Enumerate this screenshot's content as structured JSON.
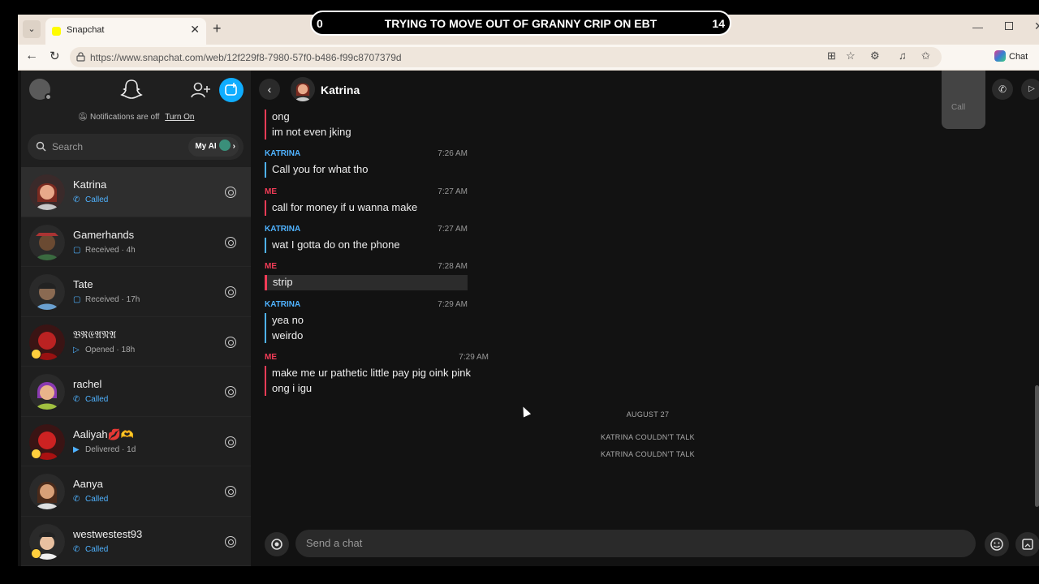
{
  "browser": {
    "tab_title": "Snapchat",
    "tab_close": "✕",
    "new_tab": "+",
    "url": "https://www.snapchat.com/web/12f229f8-7980-57f0-b486-f99c8707379d",
    "chat_badge": "Chat"
  },
  "overlay": {
    "left_number": "0",
    "text": "TRYING TO MOVE OUT OF GRANNY CRIP ON EBT",
    "right_number": "14"
  },
  "sidebar": {
    "notifications_text": "Notifications are off",
    "notifications_link": "Turn On",
    "search_placeholder": "Search",
    "my_ai_label": "My AI",
    "conversations": [
      {
        "name": "Katrina",
        "status": "Called",
        "status_type": "called",
        "icon": "phone-icon",
        "active": true
      },
      {
        "name": "Gamerhands",
        "status": "Received · 4h",
        "status_type": "received",
        "icon": "chat-bubble-icon"
      },
      {
        "name": "Tate",
        "status": "Received · 17h",
        "status_type": "received",
        "icon": "chat-bubble-icon"
      },
      {
        "name": "𝔅ℜ𝔈𝔄𝔑𝔄",
        "status": "Opened · 18h",
        "status_type": "opened",
        "icon": "arrow-outline-icon"
      },
      {
        "name": "rachel",
        "status": "Called",
        "status_type": "called",
        "icon": "phone-icon"
      },
      {
        "name": "Aaliyah💋🫶",
        "status": "Delivered · 1d",
        "status_type": "delivered",
        "icon": "arrow-filled-icon"
      },
      {
        "name": "Aanya",
        "status": "Called",
        "status_type": "called",
        "icon": "phone-icon"
      },
      {
        "name": "westwestest93",
        "status": "Called",
        "status_type": "called",
        "icon": "phone-icon"
      }
    ]
  },
  "chat": {
    "name": "Katrina",
    "call_label": "Call",
    "composer_placeholder": "Send a chat",
    "messages": [
      {
        "sender": "",
        "time": "",
        "lines": [
          "ong",
          "im not even jking"
        ],
        "from": "me"
      },
      {
        "sender": "KATRINA",
        "time": "7:26 AM",
        "lines": [
          "Call you for what tho"
        ],
        "from": "them"
      },
      {
        "sender": "ME",
        "time": "7:27 AM",
        "lines": [
          "call for money if u wanna make"
        ],
        "from": "me"
      },
      {
        "sender": "KATRINA",
        "time": "7:27 AM",
        "lines": [
          "wat I gotta do on the phone"
        ],
        "from": "them"
      },
      {
        "sender": "ME",
        "time": "7:28 AM",
        "lines": [
          "strip"
        ],
        "from": "me"
      },
      {
        "sender": "KATRINA",
        "time": "7:29 AM",
        "lines": [
          "yea no",
          "weirdo"
        ],
        "from": "them"
      },
      {
        "sender": "ME",
        "time": "7:29 AM",
        "lines": [
          "make me ur pathetic little pay pig oink pink",
          "ong i igu"
        ],
        "from": "me"
      }
    ],
    "date_separator": "AUGUST 27",
    "system_1": "KATRINA COULDN'T TALK",
    "system_2": "KATRINA COULDN'T TALK"
  },
  "colors": {
    "accent_blue": "#4fb2ff",
    "accent_red": "#f23c57",
    "new_chat_blue": "#0fadff"
  }
}
